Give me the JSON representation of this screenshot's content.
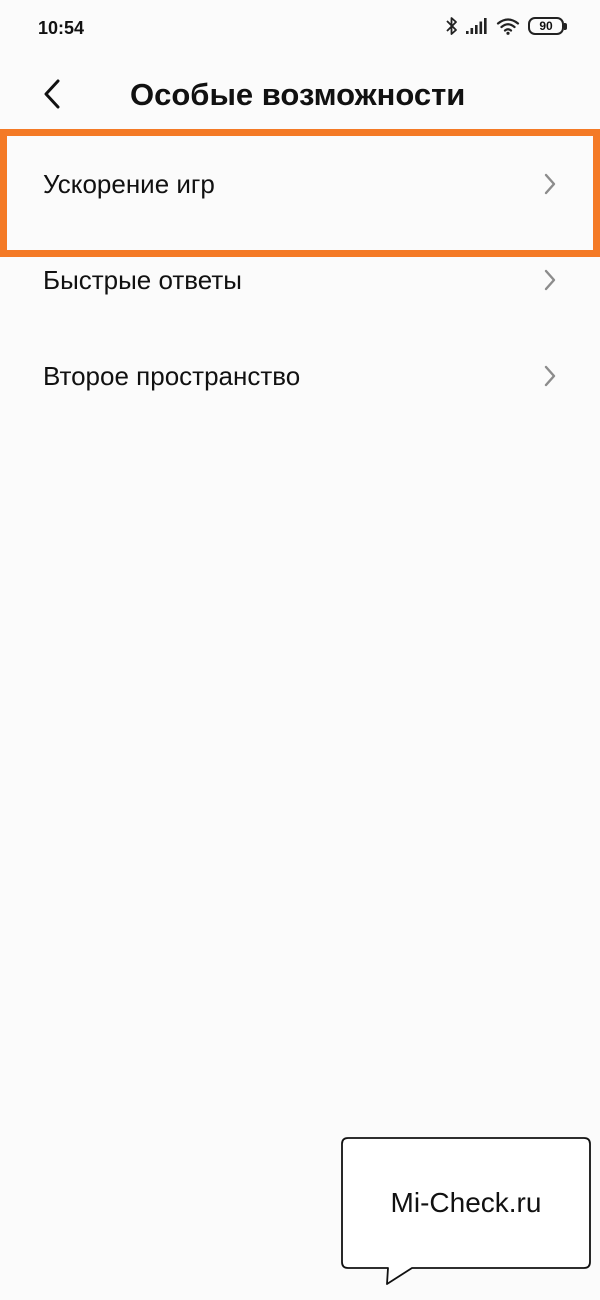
{
  "status_bar": {
    "time": "10:54",
    "icons": [
      "bluetooth-icon",
      "signal-icon",
      "wifi-icon"
    ],
    "battery": "90"
  },
  "header": {
    "back_icon": "chevron-left-icon",
    "title": "Особые возможности"
  },
  "menu": {
    "items": [
      {
        "label": "Ускорение игр",
        "icon": "chevron-right-icon",
        "highlighted": true
      },
      {
        "label": "Быстрые ответы",
        "icon": "chevron-right-icon"
      },
      {
        "label": "Второе пространство",
        "icon": "chevron-right-icon"
      }
    ]
  },
  "watermark": {
    "text": "Mi-Check.ru"
  },
  "colors": {
    "background": "#fbfbfb",
    "highlight": "#f47a26",
    "text": "#111111",
    "chevron": "#8c8c8c"
  }
}
